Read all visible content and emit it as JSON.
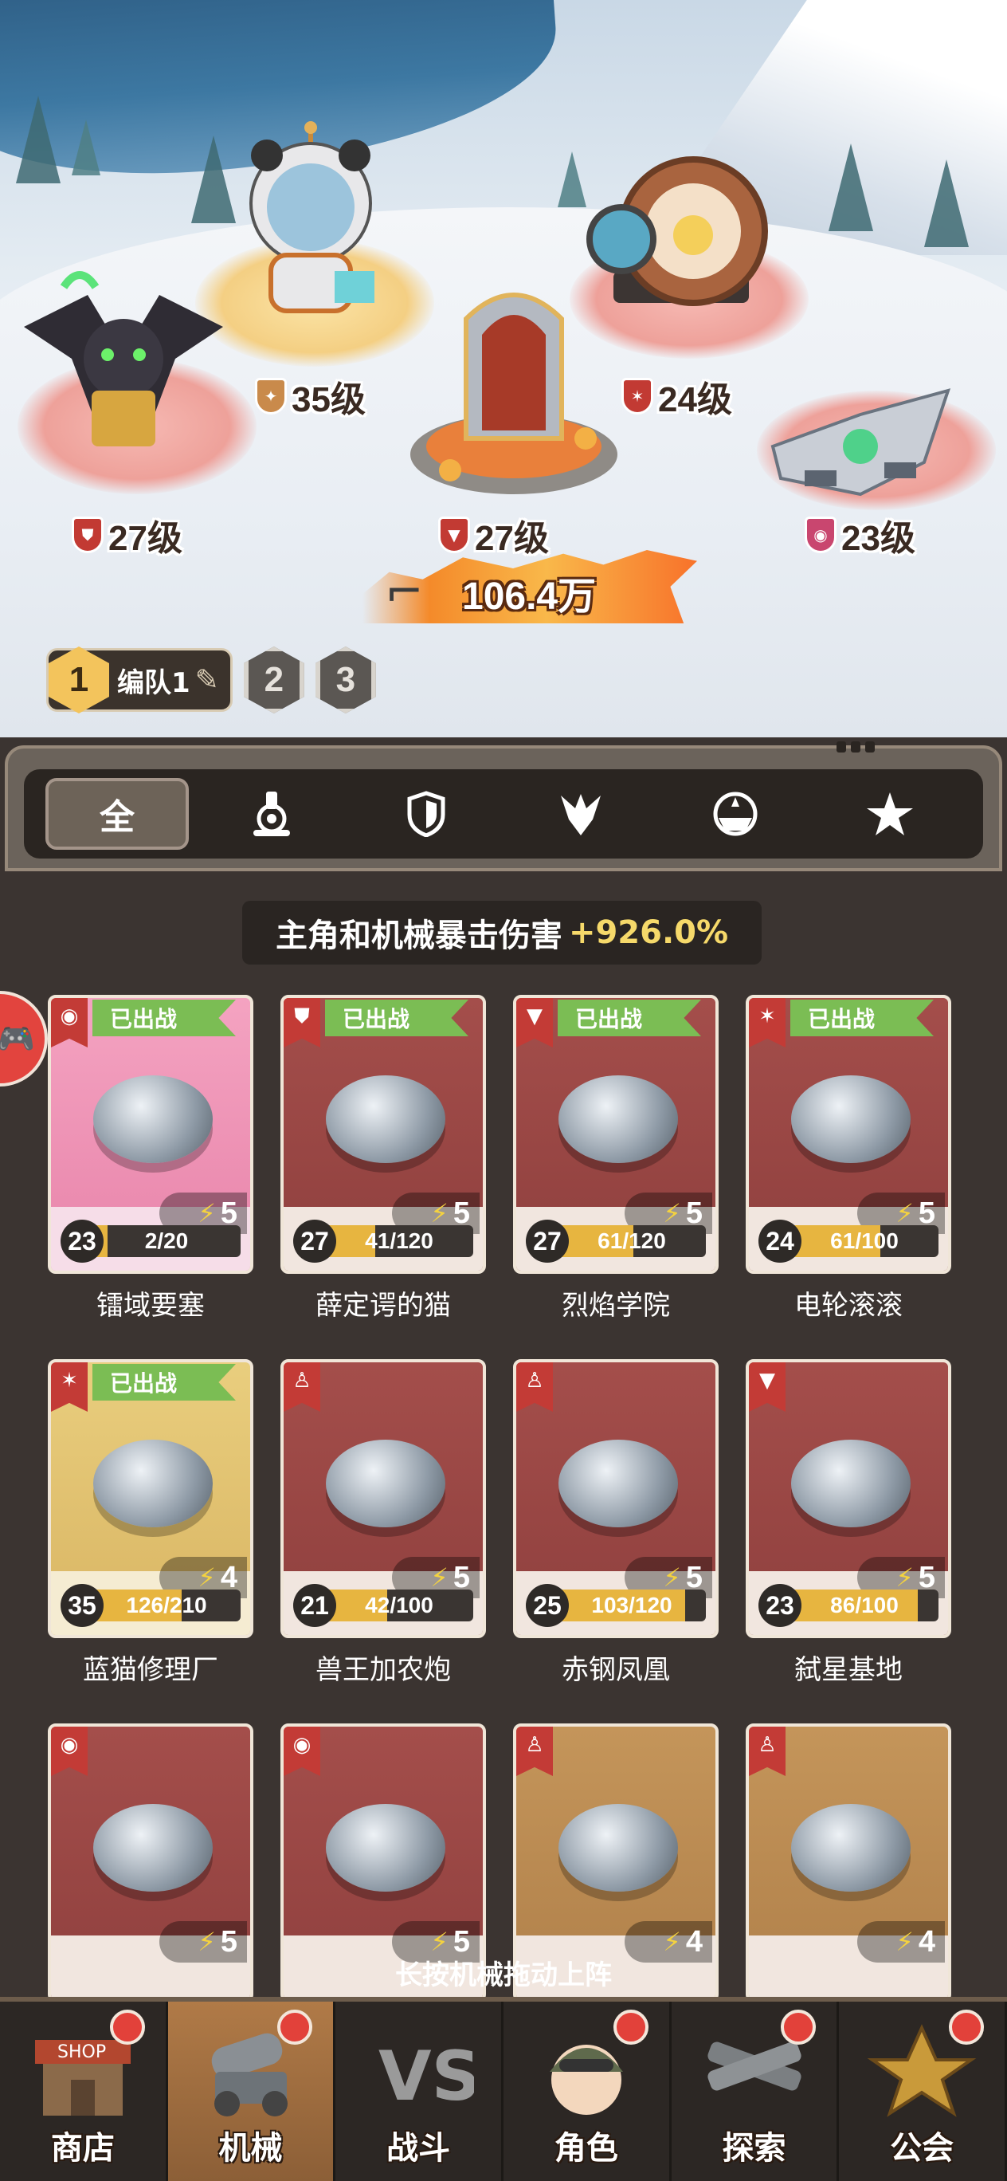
{
  "scene": {
    "units": [
      {
        "id": "bat-cat",
        "level": "27级",
        "badge": "shield"
      },
      {
        "id": "panda",
        "level": "35级",
        "badge": "gear"
      },
      {
        "id": "portal",
        "level": "27级",
        "badge": "claw"
      },
      {
        "id": "wheel",
        "level": "24级",
        "badge": "star"
      },
      {
        "id": "fortress",
        "level": "23级",
        "badge": "dome"
      }
    ],
    "power": "106.4万"
  },
  "teams": {
    "active": {
      "num": "1",
      "label": "编队1"
    },
    "others": [
      "2",
      "3"
    ]
  },
  "tabs": [
    "全",
    "turret",
    "shield",
    "claw",
    "dome",
    "star"
  ],
  "bonus": {
    "text": "主角和机械暴击伤害",
    "value": "+926.0%"
  },
  "deployed_label": "已出战",
  "cards": [
    {
      "name": "镭域要塞",
      "level": "23",
      "progress": "2/20",
      "progress_frac": 0.1,
      "energy": "5",
      "type": "dome",
      "deployed": true,
      "theme": "pink"
    },
    {
      "name": "薛定谔的猫",
      "level": "27",
      "progress": "41/120",
      "progress_frac": 0.34,
      "energy": "5",
      "type": "shield",
      "deployed": true,
      "theme": "red"
    },
    {
      "name": "烈焰学院",
      "level": "27",
      "progress": "61/120",
      "progress_frac": 0.51,
      "energy": "5",
      "type": "claw",
      "deployed": true,
      "theme": "red"
    },
    {
      "name": "电轮滚滚",
      "level": "24",
      "progress": "61/100",
      "progress_frac": 0.61,
      "energy": "5",
      "type": "star",
      "deployed": true,
      "theme": "red"
    },
    {
      "name": "蓝猫修理厂",
      "level": "35",
      "progress": "126/210",
      "progress_frac": 0.6,
      "energy": "4",
      "type": "star",
      "deployed": true,
      "theme": "gold"
    },
    {
      "name": "兽王加农炮",
      "level": "21",
      "progress": "42/100",
      "progress_frac": 0.42,
      "energy": "5",
      "type": "turret",
      "deployed": false,
      "theme": "red"
    },
    {
      "name": "赤钢凤凰",
      "level": "25",
      "progress": "103/120",
      "progress_frac": 0.86,
      "energy": "5",
      "type": "turret",
      "deployed": false,
      "theme": "red"
    },
    {
      "name": "弑星基地",
      "level": "23",
      "progress": "86/100",
      "progress_frac": 0.86,
      "energy": "5",
      "type": "claw",
      "deployed": false,
      "theme": "red"
    },
    {
      "name": "",
      "level": "",
      "progress": "",
      "energy": "5",
      "type": "dome",
      "deployed": false,
      "theme": "red"
    },
    {
      "name": "",
      "level": "",
      "progress": "",
      "energy": "5",
      "type": "dome",
      "deployed": false,
      "theme": "red"
    },
    {
      "name": "",
      "level": "",
      "progress": "",
      "energy": "4",
      "type": "turret",
      "deployed": false,
      "theme": "tan"
    },
    {
      "name": "",
      "level": "",
      "progress": "",
      "energy": "4",
      "type": "turret",
      "deployed": false,
      "theme": "tan"
    }
  ],
  "hint": "长按机械拖动上阵",
  "nav": [
    {
      "label": "商店",
      "icon": "shop-icon",
      "badge": true,
      "active": false
    },
    {
      "label": "机械",
      "icon": "cannon-icon",
      "badge": true,
      "active": true
    },
    {
      "label": "战斗",
      "icon": "vs-icon",
      "badge": false,
      "active": false
    },
    {
      "label": "角色",
      "icon": "character-icon",
      "badge": true,
      "active": false
    },
    {
      "label": "探索",
      "icon": "explore-icon",
      "badge": true,
      "active": false
    },
    {
      "label": "公会",
      "icon": "guild-icon",
      "badge": true,
      "active": false
    }
  ]
}
